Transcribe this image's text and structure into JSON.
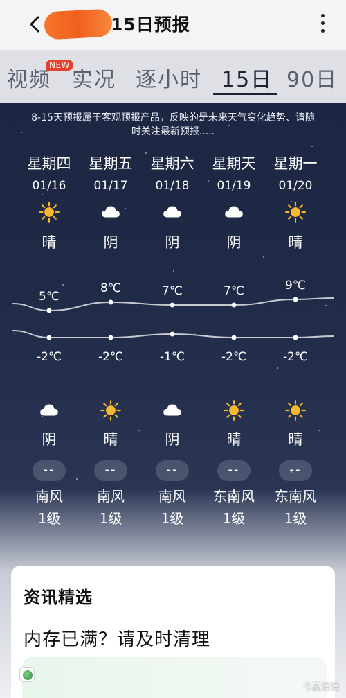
{
  "header": {
    "title": "15日预报"
  },
  "tabs": [
    {
      "label": "视频",
      "badge": "NEW"
    },
    {
      "label": "实况"
    },
    {
      "label": "逐小时"
    },
    {
      "label": "15日",
      "active": true
    },
    {
      "label": "90日"
    }
  ],
  "notice": {
    "line1": "8-15天预报属于客观预报产品，反映的是未来天气变化趋势、请随",
    "line2": "时关注最新预报....."
  },
  "days": [
    {
      "weekday": "星期四",
      "date": "01/16",
      "day_icon": "sun-icon",
      "day_cond": "晴",
      "high": "5℃",
      "low": "-2℃",
      "night_icon": "cloud-icon",
      "night_cond": "阴",
      "wind_level_placeholder": "--",
      "wind_dir": "南风",
      "wind_level": "1级"
    },
    {
      "weekday": "星期五",
      "date": "01/17",
      "day_icon": "cloud-icon",
      "day_cond": "阴",
      "high": "8℃",
      "low": "-2℃",
      "night_icon": "sun-icon",
      "night_cond": "晴",
      "wind_level_placeholder": "--",
      "wind_dir": "南风",
      "wind_level": "1级"
    },
    {
      "weekday": "星期六",
      "date": "01/18",
      "day_icon": "cloud-icon",
      "day_cond": "阴",
      "high": "7℃",
      "low": "-1℃",
      "night_icon": "cloud-icon",
      "night_cond": "阴",
      "wind_level_placeholder": "--",
      "wind_dir": "南风",
      "wind_level": "1级"
    },
    {
      "weekday": "星期天",
      "date": "01/19",
      "day_icon": "cloud-icon",
      "day_cond": "阴",
      "high": "7℃",
      "low": "-2℃",
      "night_icon": "sun-icon",
      "night_cond": "晴",
      "wind_level_placeholder": "--",
      "wind_dir": "东南风",
      "wind_level": "1级"
    },
    {
      "weekday": "星期一",
      "date": "01/20",
      "day_icon": "sun-icon",
      "day_cond": "晴",
      "high": "9℃",
      "low": "-2℃",
      "night_icon": "sun-icon",
      "night_cond": "晴",
      "wind_level_placeholder": "--",
      "wind_dir": "东南风",
      "wind_level": "1级"
    }
  ],
  "chart_data": {
    "type": "line",
    "categories": [
      "01/16",
      "01/17",
      "01/18",
      "01/19",
      "01/20"
    ],
    "series": [
      {
        "values": [
          5,
          8,
          7,
          7,
          9
        ]
      },
      {
        "values": [
          -2,
          -2,
          -1,
          -2,
          -2
        ]
      }
    ]
  },
  "news": {
    "title": "资讯精选",
    "message": "内存已满？请及时清理"
  },
  "watermark": "今夏漫漫",
  "colors": {
    "sun": "#f5b82e",
    "cloud": "#ffffff",
    "badge": "#e4412f"
  }
}
